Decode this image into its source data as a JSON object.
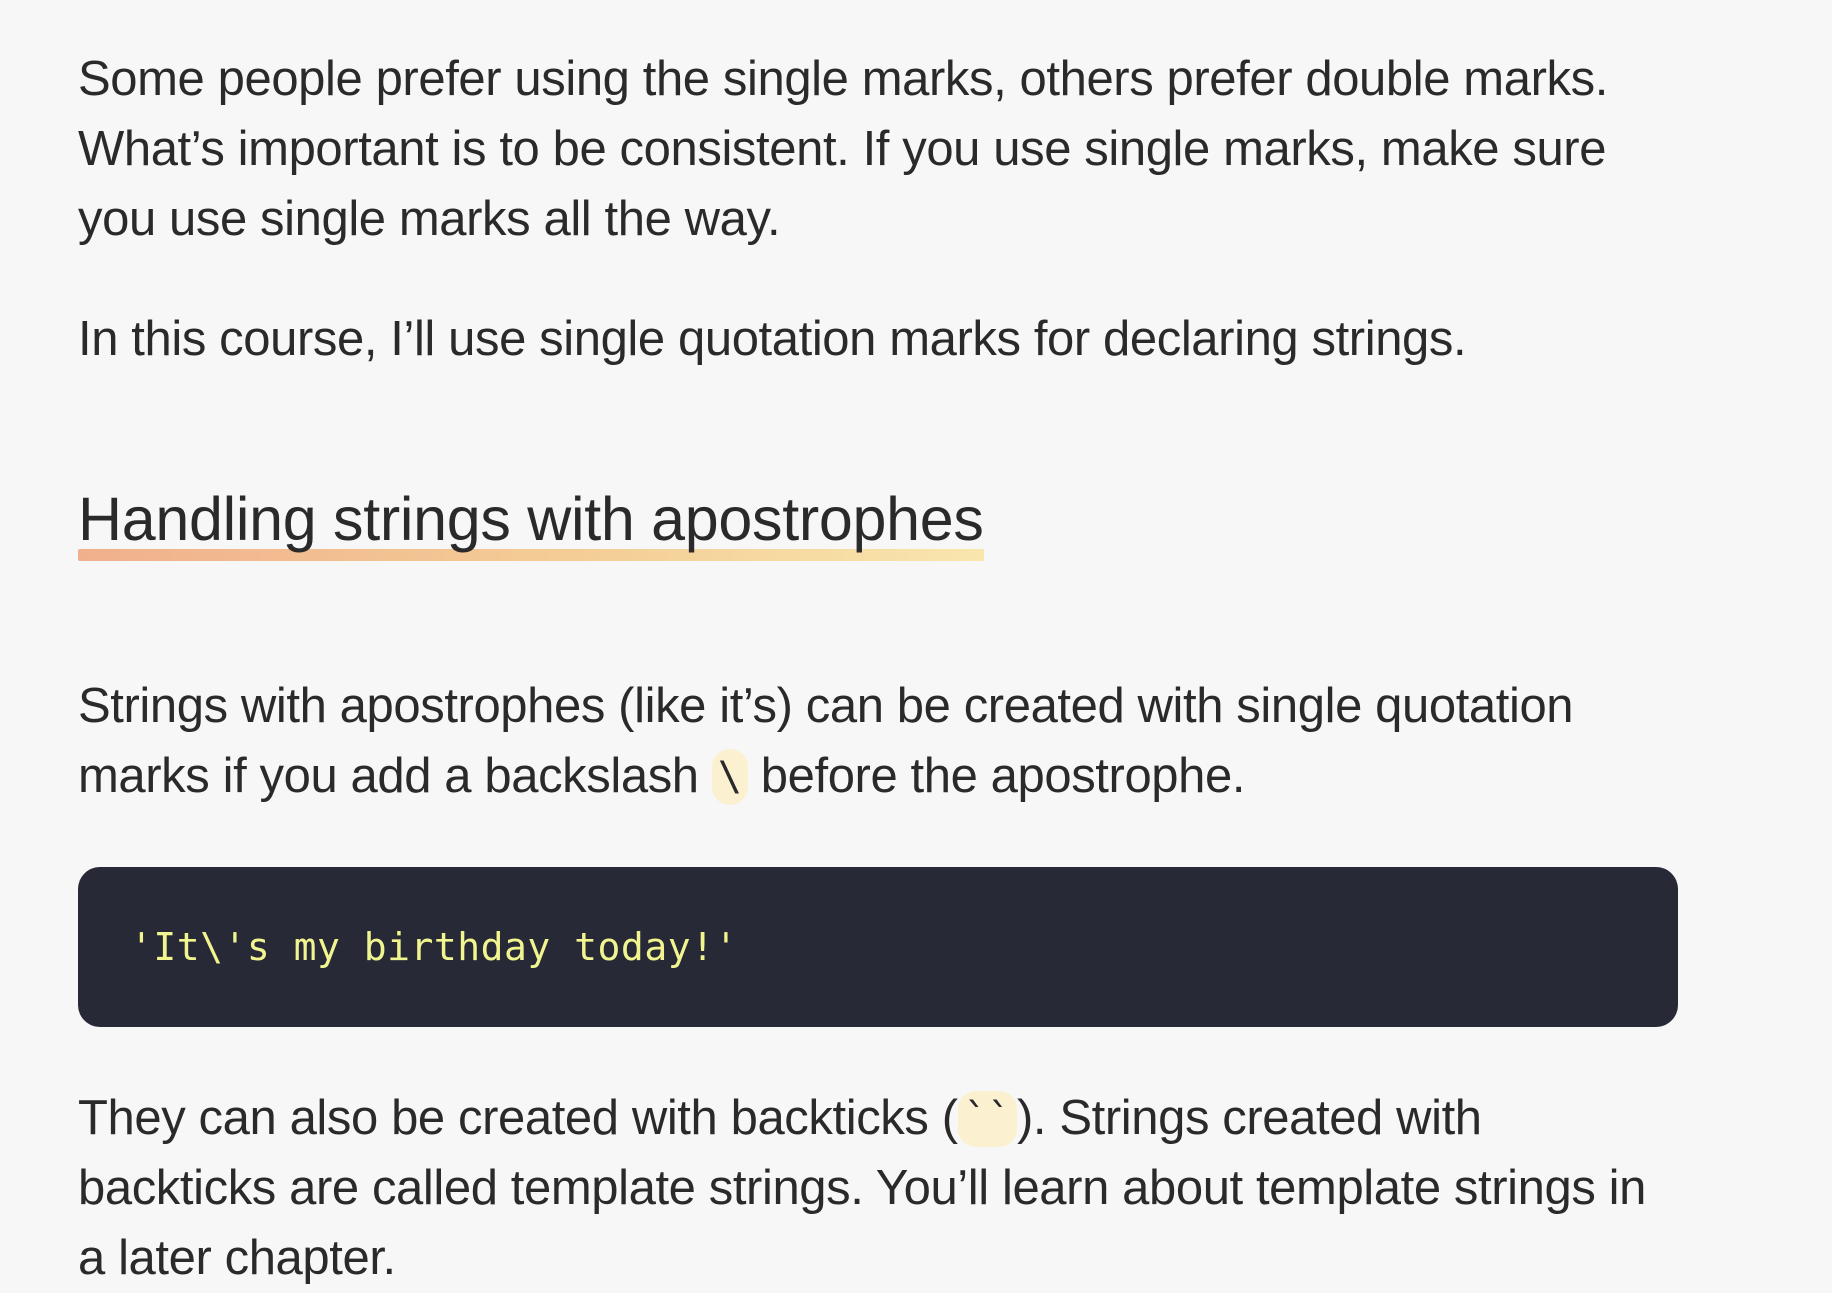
{
  "paragraphs": {
    "p1": "Some people prefer using the single marks, others prefer double marks. What’s important is to be consistent. If you use single marks, make sure you use single marks all the way.",
    "p2": "In this course, I’ll use single quotation marks for declaring strings."
  },
  "section": {
    "heading": "Handling strings with apostrophes",
    "p3_before": "Strings with apostrophes (like it’s) can be created with single quotation marks if you add a backslash ",
    "p3_code": "\\",
    "p3_after": " before the apostrophe.",
    "code_block": "'It\\'s my birthday today!'",
    "p4_before": "They can also be created with backticks (",
    "p4_code": "``",
    "p4_after": "). Strings created with backticks are called template strings. You’ll learn about template strings in a later chapter."
  },
  "colors": {
    "background": "#f7f7f7",
    "text": "#2a2a2a",
    "code_block_bg": "#282936",
    "code_block_text": "#f1f58f",
    "inline_code_bg": "#fbf0cf",
    "heading_underline_start": "#f0b08c",
    "heading_underline_end": "#f8e6ad"
  }
}
